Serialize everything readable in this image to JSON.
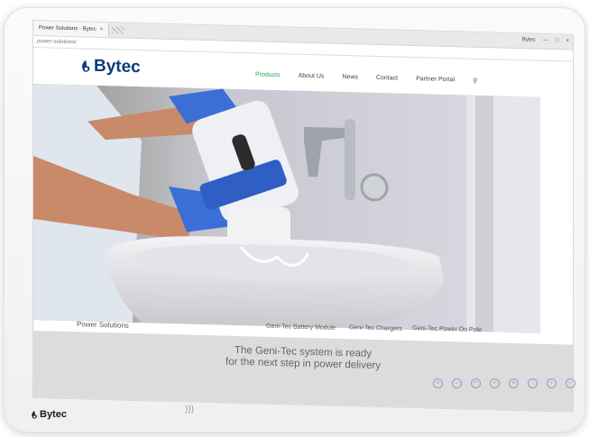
{
  "browser": {
    "tab_title": "Power Solutions - Bytec",
    "tab_close": "×",
    "url": "power-solutions/",
    "window_user": "Bytec",
    "window_controls": [
      "—",
      "□",
      "×"
    ]
  },
  "header": {
    "logo_text": "Bytec",
    "menu": [
      "Products",
      "About Us",
      "News",
      "Contact",
      "Partner Portal"
    ],
    "active_item": "Products"
  },
  "subnav": {
    "section": "Power Solutions",
    "links": [
      "Geni-Tec Battery Module",
      "Geni-Tec Chargers",
      "Geni-Tec Power On Pole"
    ]
  },
  "banner": {
    "line1": "The Geni-Tec system is ready",
    "line2": "for the next step in power delivery"
  },
  "device": {
    "bottom_logo": "Bytec",
    "nfc_symbol": ")))"
  },
  "colors": {
    "brand_blue": "#0a3c7a",
    "active_green": "#2aa84a",
    "glove_blue": "#3b6fd6"
  }
}
